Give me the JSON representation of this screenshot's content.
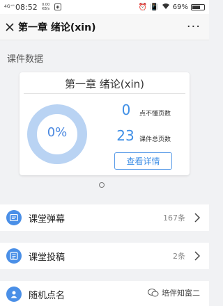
{
  "status_bar": {
    "signal": "4G⁺ᵗᴸ",
    "time": "08:52",
    "net_speed": "0.00 KB/s",
    "battery": "69%",
    "battery_level": 0.69
  },
  "nav": {
    "title": "第一章 绪论(xin)",
    "more": "···"
  },
  "section_title": "课件数据",
  "card": {
    "title": "第一章 绪论(xin)",
    "percent": "0%",
    "percent_value": 0,
    "unclear_pages_count": "0",
    "unclear_pages_label": "点不懂页数",
    "total_pages_count": "23",
    "total_pages_label": "课件总页数",
    "detail_button": "查看详情",
    "colors": {
      "ring": "#b9d3f3",
      "accent": "#3f8fe6"
    }
  },
  "list": [
    {
      "label": "课堂弹幕",
      "count": "167条",
      "icon": "barrage-icon"
    },
    {
      "label": "课堂投稿",
      "count": "2条",
      "icon": "submission-icon"
    },
    {
      "label": "随机点名",
      "count": "",
      "icon": "person-icon"
    }
  ],
  "watermark": {
    "text": "培伴知富二"
  }
}
